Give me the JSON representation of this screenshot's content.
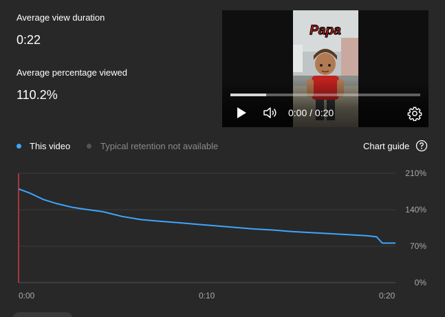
{
  "metrics": {
    "avg_view_duration_label": "Average view duration",
    "avg_view_duration_value": "0:22",
    "avg_percentage_label": "Average percentage viewed",
    "avg_percentage_value": "110.2%"
  },
  "player": {
    "thumbnail_text": "Papa",
    "time_display": "0:00 / 0:20",
    "progress_fraction": 0.19,
    "play_icon": "play-icon",
    "volume_icon": "volume-icon",
    "settings_icon": "gear-icon"
  },
  "legend": {
    "this_video": "This video",
    "typical": "Typical retention not available",
    "this_video_color": "#3ea6ff",
    "typical_color": "#555555",
    "chart_guide": "Chart guide"
  },
  "chart_data": {
    "type": "line",
    "x": [
      0,
      0.6,
      1.3,
      2.0,
      2.8,
      3.5,
      4.5,
      5.5,
      6.5,
      7.5,
      8.5,
      9.5,
      10.5,
      11.5,
      12.5,
      13.5,
      14.5,
      15.5,
      16.5,
      17.5,
      18.5,
      19.0,
      19.3,
      20.0
    ],
    "y": [
      180,
      172,
      160,
      152,
      145,
      141,
      136,
      127,
      121,
      118,
      115,
      112,
      109,
      106,
      103,
      101,
      98,
      96,
      94,
      92,
      90,
      88,
      76,
      76
    ],
    "x_tick_labels": [
      "0:00",
      "0:10",
      "0:20"
    ],
    "x_ticks": [
      0,
      10,
      20
    ],
    "y_tick_labels": [
      "210%",
      "140%",
      "70%",
      "0%"
    ],
    "y_ticks": [
      210,
      140,
      70,
      0
    ],
    "xlim": [
      0,
      20
    ],
    "ylim": [
      0,
      210
    ],
    "series": [
      {
        "name": "This video",
        "color": "#3ea6ff"
      }
    ],
    "grid": true
  }
}
